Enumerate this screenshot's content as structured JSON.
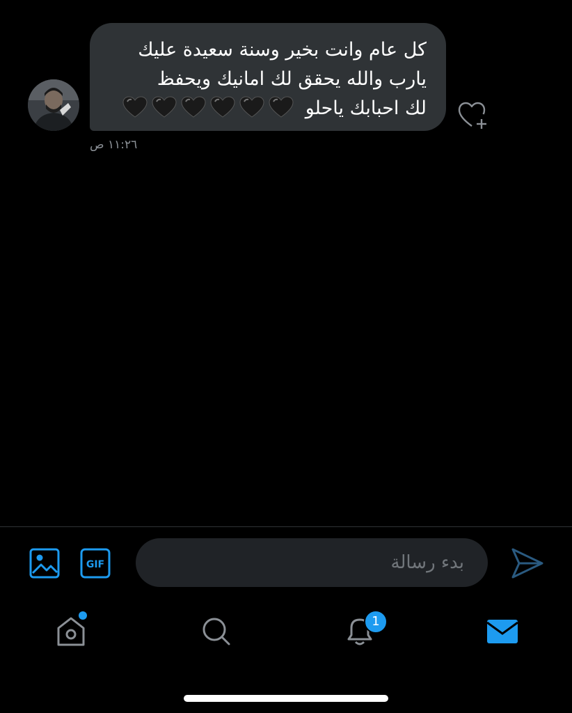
{
  "message": {
    "lines": [
      "كل عام وانت بخير وسنة سعيدة عليك",
      "يارب والله يحقق لك امانيك ويحفظ",
      "لك احبابك ياحلو"
    ],
    "emoji": [
      "🖤",
      "🖤",
      "🖤",
      "🖤",
      "🖤",
      "🖤"
    ],
    "timestamp": "١١:٢٦ ص"
  },
  "composer": {
    "placeholder": "بدء رسالة",
    "gif_label": "GIF"
  },
  "tabs": {
    "notifications_badge": "1"
  },
  "colors": {
    "accent": "#1d9bf0",
    "bubble": "#2f3336",
    "background": "#000000"
  }
}
